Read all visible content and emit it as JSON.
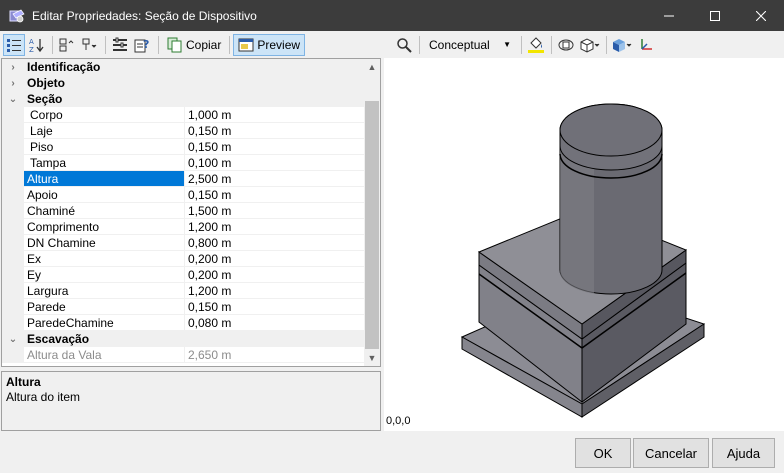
{
  "window": {
    "title": "Editar Propriedades: Seção de Dispositivo",
    "controls": [
      "minimize-icon",
      "maximize-icon",
      "close-icon"
    ]
  },
  "left_toolbar": {
    "copy_label": "Copiar",
    "preview_label": "Preview"
  },
  "property_grid": {
    "categories": {
      "identificacao": "Identificação",
      "objeto": "Objeto",
      "secao": "Seção",
      "escavacao": "Escavação"
    },
    "secao_rows": [
      {
        "name": "Corpo",
        "value": "1,000 m"
      },
      {
        "name": "Laje",
        "value": "0,150 m"
      },
      {
        "name": "Piso",
        "value": "0,150 m"
      },
      {
        "name": "Tampa",
        "value": "0,100 m"
      },
      {
        "name": "Altura",
        "value": "2,500 m"
      },
      {
        "name": "Apoio",
        "value": "0,150 m"
      },
      {
        "name": "Chaminé",
        "value": "1,500 m"
      },
      {
        "name": "Comprimento",
        "value": "1,200 m"
      },
      {
        "name": "DN Chamine",
        "value": "0,800 m"
      },
      {
        "name": "Ex",
        "value": "0,200 m"
      },
      {
        "name": "Ey",
        "value": "0,200 m"
      },
      {
        "name": "Largura",
        "value": "1,200 m"
      },
      {
        "name": "Parede",
        "value": "0,150 m"
      },
      {
        "name": "ParedeChamine",
        "value": "0,080 m"
      }
    ],
    "escavacao_rows": [
      {
        "name": "Altura da Vala",
        "value": "2,650 m"
      }
    ]
  },
  "description": {
    "title": "Altura",
    "text": "Altura do item"
  },
  "right_toolbar": {
    "visual_style": "Conceptual"
  },
  "viewport": {
    "coordinates": "0,0,0"
  },
  "footer": {
    "ok_label": "OK",
    "cancel_label": "Cancelar",
    "help_label": "Ajuda"
  },
  "colors": {
    "titlebar": "#3c3c3c",
    "selection": "#0078d7",
    "toggle_active": "#cce4f7",
    "model_gray": "#6a6a72"
  }
}
